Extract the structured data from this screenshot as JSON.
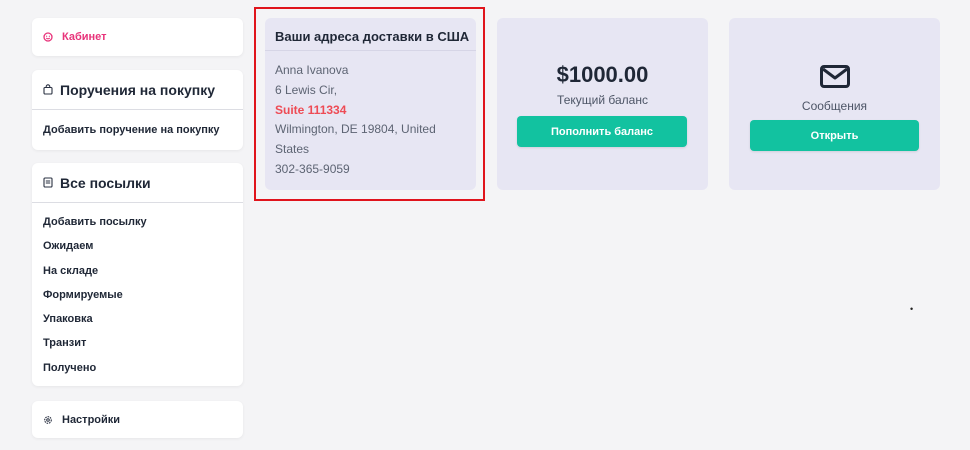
{
  "sidebar": {
    "cabinet_label": "Кабинет",
    "orders": {
      "title": "Поручения на покупку",
      "items": [
        "Добавить поручение на покупку"
      ]
    },
    "parcels": {
      "title": "Все посылки",
      "items": [
        "Добавить посылку",
        "Ожидаем",
        "На складе",
        "Формируемые",
        "Упаковка",
        "Транзит",
        "Получено"
      ]
    },
    "settings_label": "Настройки"
  },
  "address": {
    "title": "Ваши адреса доставки в США",
    "name": "Anna Ivanova",
    "street": "6 Lewis Cir,",
    "suite": "Suite 111334",
    "city_line1": "Wilmington, DE 19804, United",
    "city_line2": "States",
    "phone": "302-365-9059"
  },
  "balance": {
    "amount": "$1000.00",
    "label": "Текущий баланс",
    "button_label": "Пополнить баланс"
  },
  "messages": {
    "label": "Сообщения",
    "button_label": "Открыть",
    "icon": "envelope-icon"
  },
  "colors": {
    "accent_pink": "#e8337a",
    "suite_red": "#ee4b55",
    "button_green": "#12c2a0",
    "highlight_red": "#e0141c",
    "tile_bg": "#e7e6f3"
  },
  "stray_mark": "•"
}
